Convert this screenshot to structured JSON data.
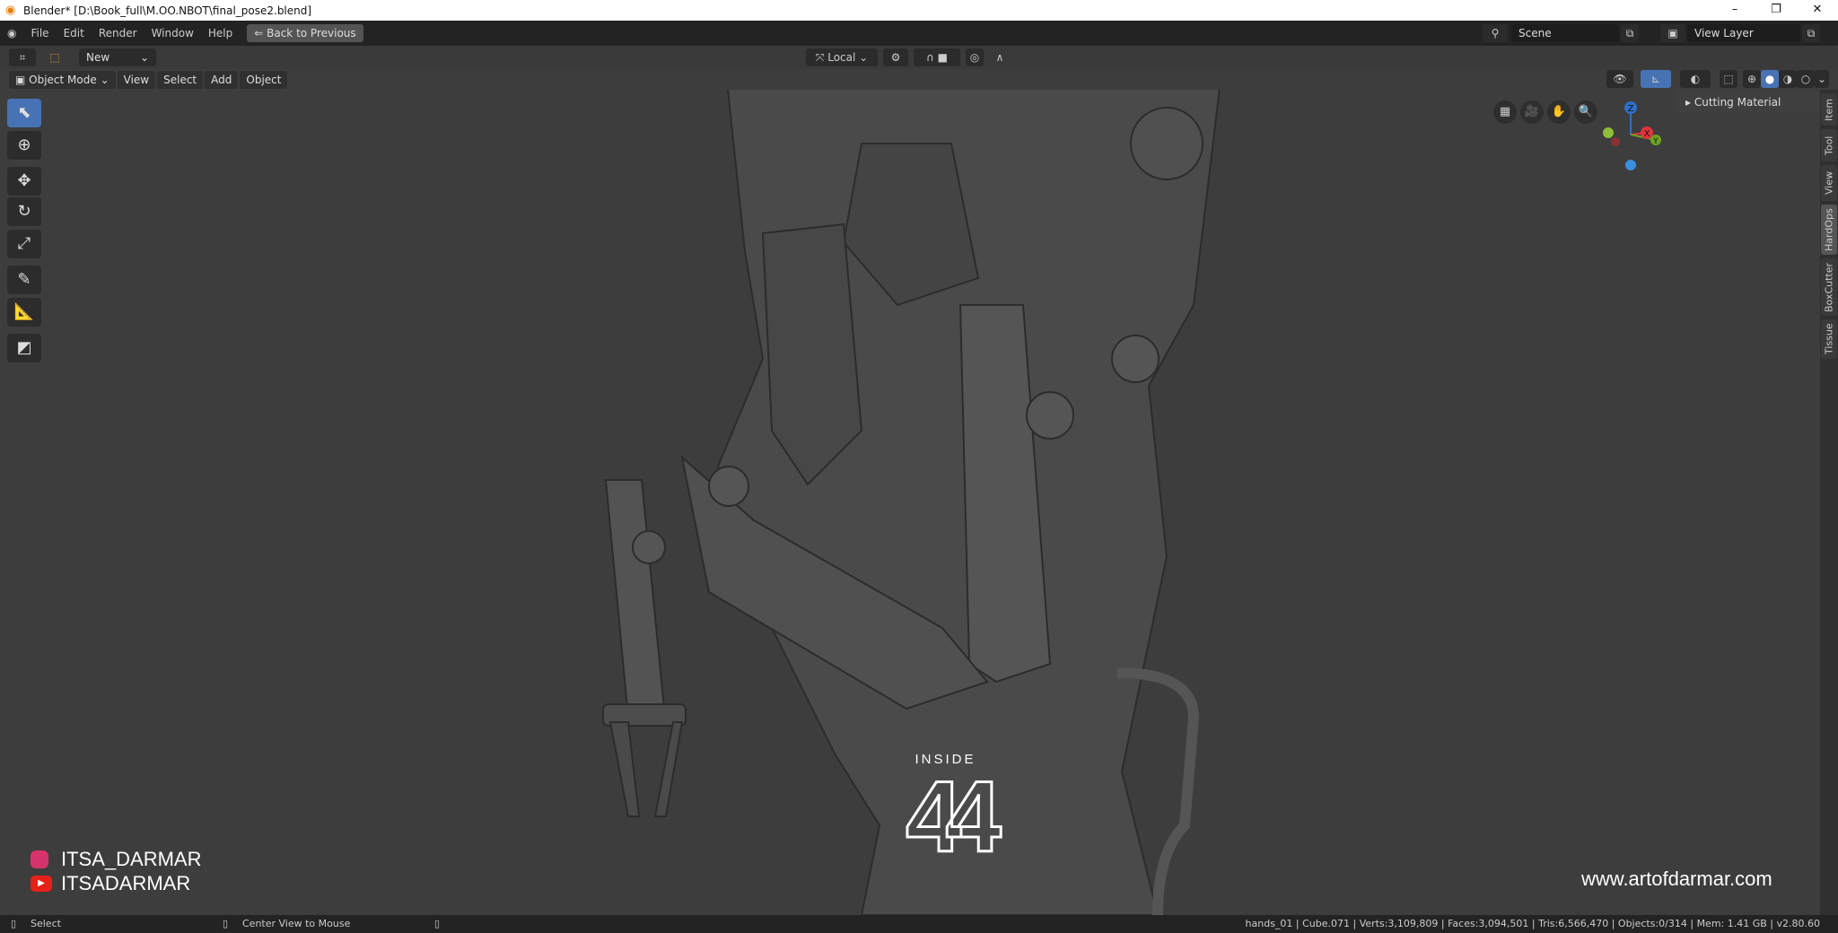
{
  "window": {
    "title": "Blender* [D:\\Book_full\\M.OO.NBOT\\final_pose2.blend]",
    "minimize": "–",
    "restore": "❐",
    "close": "✕"
  },
  "menu": {
    "items": [
      "File",
      "Edit",
      "Render",
      "Window",
      "Help"
    ],
    "back_button": "Back to Previous",
    "scene": "Scene",
    "view_layer": "View Layer"
  },
  "tool_header": {
    "brush_name": "New",
    "transform_orientation": "Local"
  },
  "viewport_header": {
    "mode": "Object Mode",
    "menus": [
      "View",
      "Select",
      "Add",
      "Object"
    ]
  },
  "sidebar": {
    "panel": "Cutting Material",
    "tabs": [
      "Item",
      "Tool",
      "View",
      "HardOps",
      "BoxCutter",
      "Tissue"
    ],
    "active_tab": "HardOps"
  },
  "gizmo": {
    "axes": [
      "Z",
      "X",
      "Y"
    ]
  },
  "overlay": {
    "instagram": "ITSA_DARMAR",
    "youtube": "ITSADARMAR",
    "website": "www.artofdarmar.com",
    "logo_text": "INSIDE",
    "logo_number": "44"
  },
  "status": {
    "left": "Select",
    "middle": "Center View to Mouse",
    "stats": "hands_01 | Cube.071 | Verts:3,109,809 | Faces:3,094,501 | Tris:6,566,470 | Objects:0/314 | Mem: 1.41 GB | v2.80.60"
  },
  "colors": {
    "accent": "#4772b3",
    "x_axis": "#e0343d",
    "y_axis": "#6fa321",
    "z_axis": "#2f6fc9"
  }
}
